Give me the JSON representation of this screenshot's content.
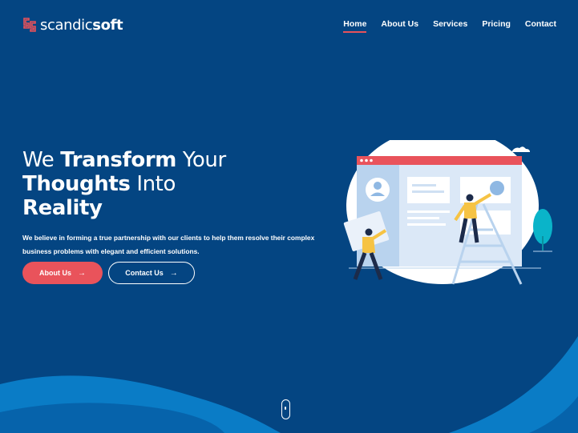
{
  "brand": {
    "name_light": "scandic",
    "name_bold": "soft",
    "logo_icon": "scandicsoft-logo-icon"
  },
  "nav": {
    "items": [
      {
        "label": "Home",
        "active": true
      },
      {
        "label": "About Us",
        "active": false
      },
      {
        "label": "Services",
        "active": false
      },
      {
        "label": "Pricing",
        "active": false
      },
      {
        "label": "Contact",
        "active": false
      }
    ]
  },
  "hero": {
    "title_part1": "We ",
    "title_part2": "Transform",
    "title_part3": " Your",
    "title_part4": "Thoughts",
    "title_part5": " Into",
    "title_part6": "Reality",
    "subtitle": "We believe in forming a true partnership with our clients to help them resolve their complex business problems with elegant and efficient solutions.",
    "primary_button": "About Us",
    "secondary_button": "Contact Us",
    "button_icon": "arrow-right-icon"
  },
  "colors": {
    "background": "#044582",
    "accent": "#e9535b",
    "wave_light": "#0a7cc6",
    "wave_mid": "#0663ab"
  },
  "scroll_indicator_icon": "mouse-scroll-icon",
  "illustration_icon": "team-building-website-illustration"
}
